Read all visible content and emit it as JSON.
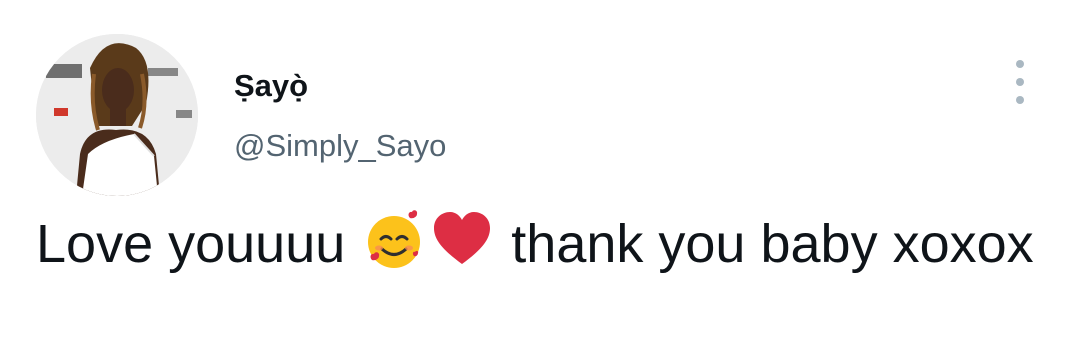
{
  "tweet": {
    "display_name": "Ṣayọ̀",
    "handle": "@Simply_Sayo",
    "text_before_emoji": "Love youuuu",
    "emoji": [
      "smiling-face-with-hearts-icon",
      "red-heart-icon"
    ],
    "text_after_emoji": "thank you baby xoxox"
  },
  "icons": {
    "more_menu": "vertical-ellipsis-icon"
  },
  "colors": {
    "text_primary": "#0f1419",
    "text_secondary": "#536471",
    "more_icon": "#aab8c2",
    "heart": "#dd2e44"
  }
}
